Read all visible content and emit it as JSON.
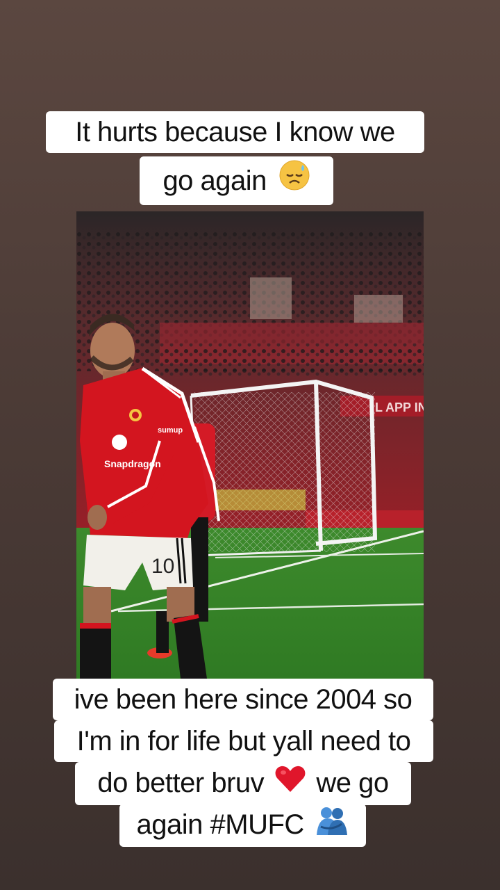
{
  "top_caption": {
    "line1": "It hurts because I know we",
    "line2": "go again",
    "line2_emoji": "sad-sweat-face-emoji"
  },
  "video": {
    "jersey_number": "10",
    "sponsor_text": "Snapdragon",
    "sleeve_text": "sumup",
    "ad_board_text": "L APP IN"
  },
  "bottom_caption": {
    "line1": "ive been here since 2004 so",
    "line2": "I'm in for life but yall need to",
    "line3_before": "do better bruv",
    "line3_emoji": "red-heart-emoji",
    "line3_after": "we go",
    "line4": "again #MUFC",
    "line4_emoji": "people-hugging-emoji"
  },
  "colors": {
    "background": "#4d3c37",
    "caption_bg": "#ffffff",
    "kit_red": "#d3151f",
    "pitch_green": "#3f8f2e"
  }
}
